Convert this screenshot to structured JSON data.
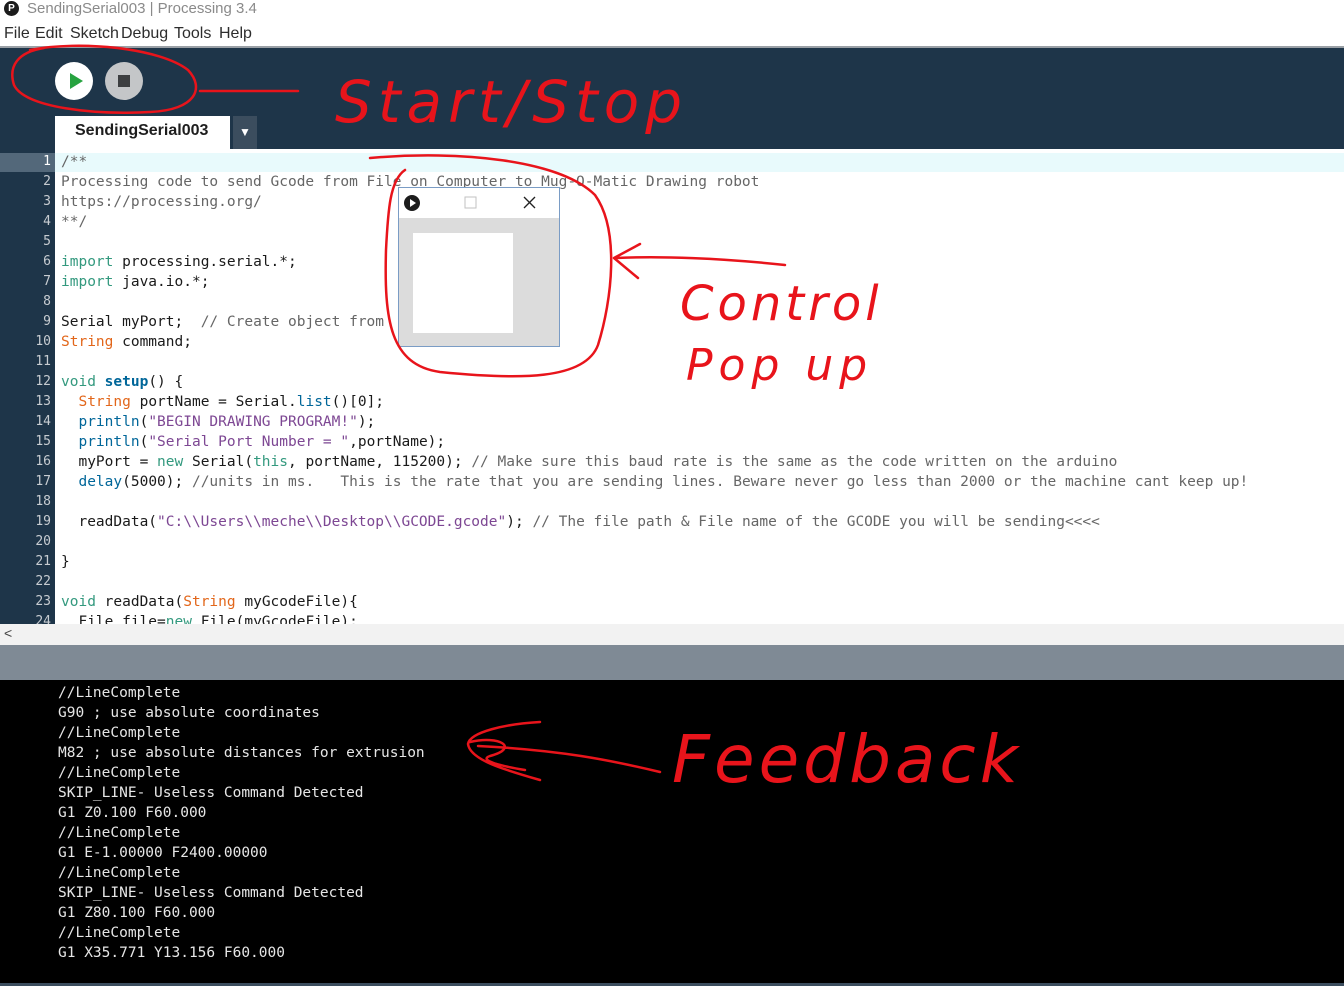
{
  "window": {
    "title": "SendingSerial003 | Processing 3.4"
  },
  "menu": [
    "File",
    "Edit",
    "Sketch",
    "Debug",
    "Tools",
    "Help"
  ],
  "toolbar": {
    "run_icon": "play-icon",
    "stop_icon": "stop-icon"
  },
  "tabs": [
    {
      "label": "SendingSerial003"
    }
  ],
  "tab_menu_glyph": "▼",
  "editor": {
    "line_numbers": [
      "1",
      "2",
      "3",
      "4",
      "5",
      "6",
      "7",
      "8",
      "9",
      "10",
      "11",
      "12",
      "13",
      "14",
      "15",
      "16",
      "17",
      "18",
      "19",
      "20",
      "21",
      "22",
      "23",
      "24"
    ],
    "current_line": 1
  },
  "hscroll_glyph": "<",
  "console": {
    "lines": [
      "//LineComplete",
      "G90 ; use absolute coordinates",
      "//LineComplete",
      "M82 ; use absolute distances for extrusion",
      "//LineComplete",
      "SKIP_LINE- Useless Command Detected",
      "G1 Z0.100 F60.000",
      "//LineComplete",
      "G1 E-1.00000 F2400.00000",
      "//LineComplete",
      "SKIP_LINE- Useless Command Detected",
      "G1 Z80.100 F60.000",
      "//LineComplete",
      "G1 X35.771 Y13.156 F60.000"
    ]
  },
  "popup": {
    "icon": "processing-play-icon",
    "maximize_icon": "maximize-icon",
    "close_icon": "close-icon"
  },
  "annotations": {
    "start_stop": "Start/Stop",
    "control_popup_1": "Control",
    "control_popup_2": "Pop up",
    "feedback": "Feedback",
    "ink_color": "#e8141b"
  },
  "colors": {
    "toolbar_bg": "#1e3549",
    "run_green": "#27a340",
    "console_bg": "#000000"
  }
}
